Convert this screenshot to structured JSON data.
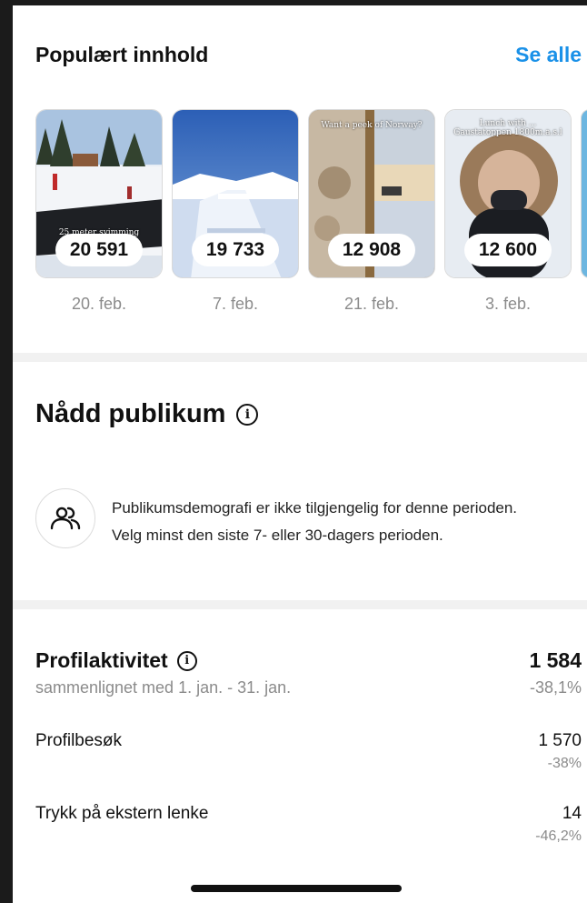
{
  "popular": {
    "title": "Populært innhold",
    "see_all": "Se alle",
    "items": [
      {
        "count": "20 591",
        "date": "20. feb.",
        "caption": "25 meter svimming"
      },
      {
        "count": "19 733",
        "date": "7. feb.",
        "caption": ""
      },
      {
        "count": "12 908",
        "date": "21. feb.",
        "caption": "Want a peek of Norway?"
      },
      {
        "count": "12 600",
        "date": "3. feb.",
        "caption": "Lunch with ... Gaustatoppen 1800m.a.s.l"
      }
    ]
  },
  "audience": {
    "title": "Nådd publikum",
    "line1": "Publikumsdemografi er ikke tilgjengelig for denne perioden.",
    "line2": "Velg minst den siste 7- eller 30-dagers perioden."
  },
  "profile": {
    "title": "Profilaktivitet",
    "subtitle": "sammenlignet med 1. jan. - 31. jan.",
    "total": "1 584",
    "total_change": "-38,1%",
    "rows": [
      {
        "label": "Profilbesøk",
        "value": "1 570",
        "change": "-38%"
      },
      {
        "label": "Trykk på ekstern lenke",
        "value": "14",
        "change": "-46,2%"
      }
    ]
  },
  "colors": {
    "accent": "#1a91e8"
  },
  "icons": {
    "info": "info-icon",
    "audience": "people-icon"
  }
}
